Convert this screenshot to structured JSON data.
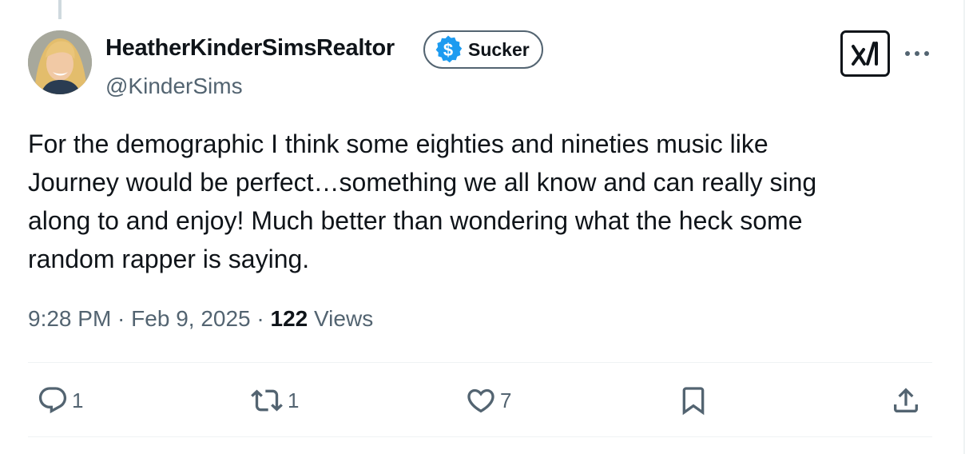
{
  "author": {
    "display_name": "HeatherKinderSimsRealtor",
    "handle": "@KinderSims",
    "badge_label": "Sucker",
    "badge_icon": "dollar-icon",
    "badge_color": "#1d9bf0"
  },
  "tweet": {
    "text": "For the demographic I think some eighties and nineties music like\nJourney would be perfect…something we all know and can really sing\nalong to and enjoy! Much better than wondering what the heck some\nrandom rapper is saying."
  },
  "meta": {
    "time": "9:28 PM",
    "separator": " · ",
    "date": "Feb 9, 2025",
    "views_count": "122",
    "views_label": " Views"
  },
  "actions": {
    "reply_count": "1",
    "retweet_count": "1",
    "like_count": "7"
  },
  "colors": {
    "text_primary": "#0f1419",
    "text_secondary": "#536471",
    "divider": "#eff3f4"
  }
}
